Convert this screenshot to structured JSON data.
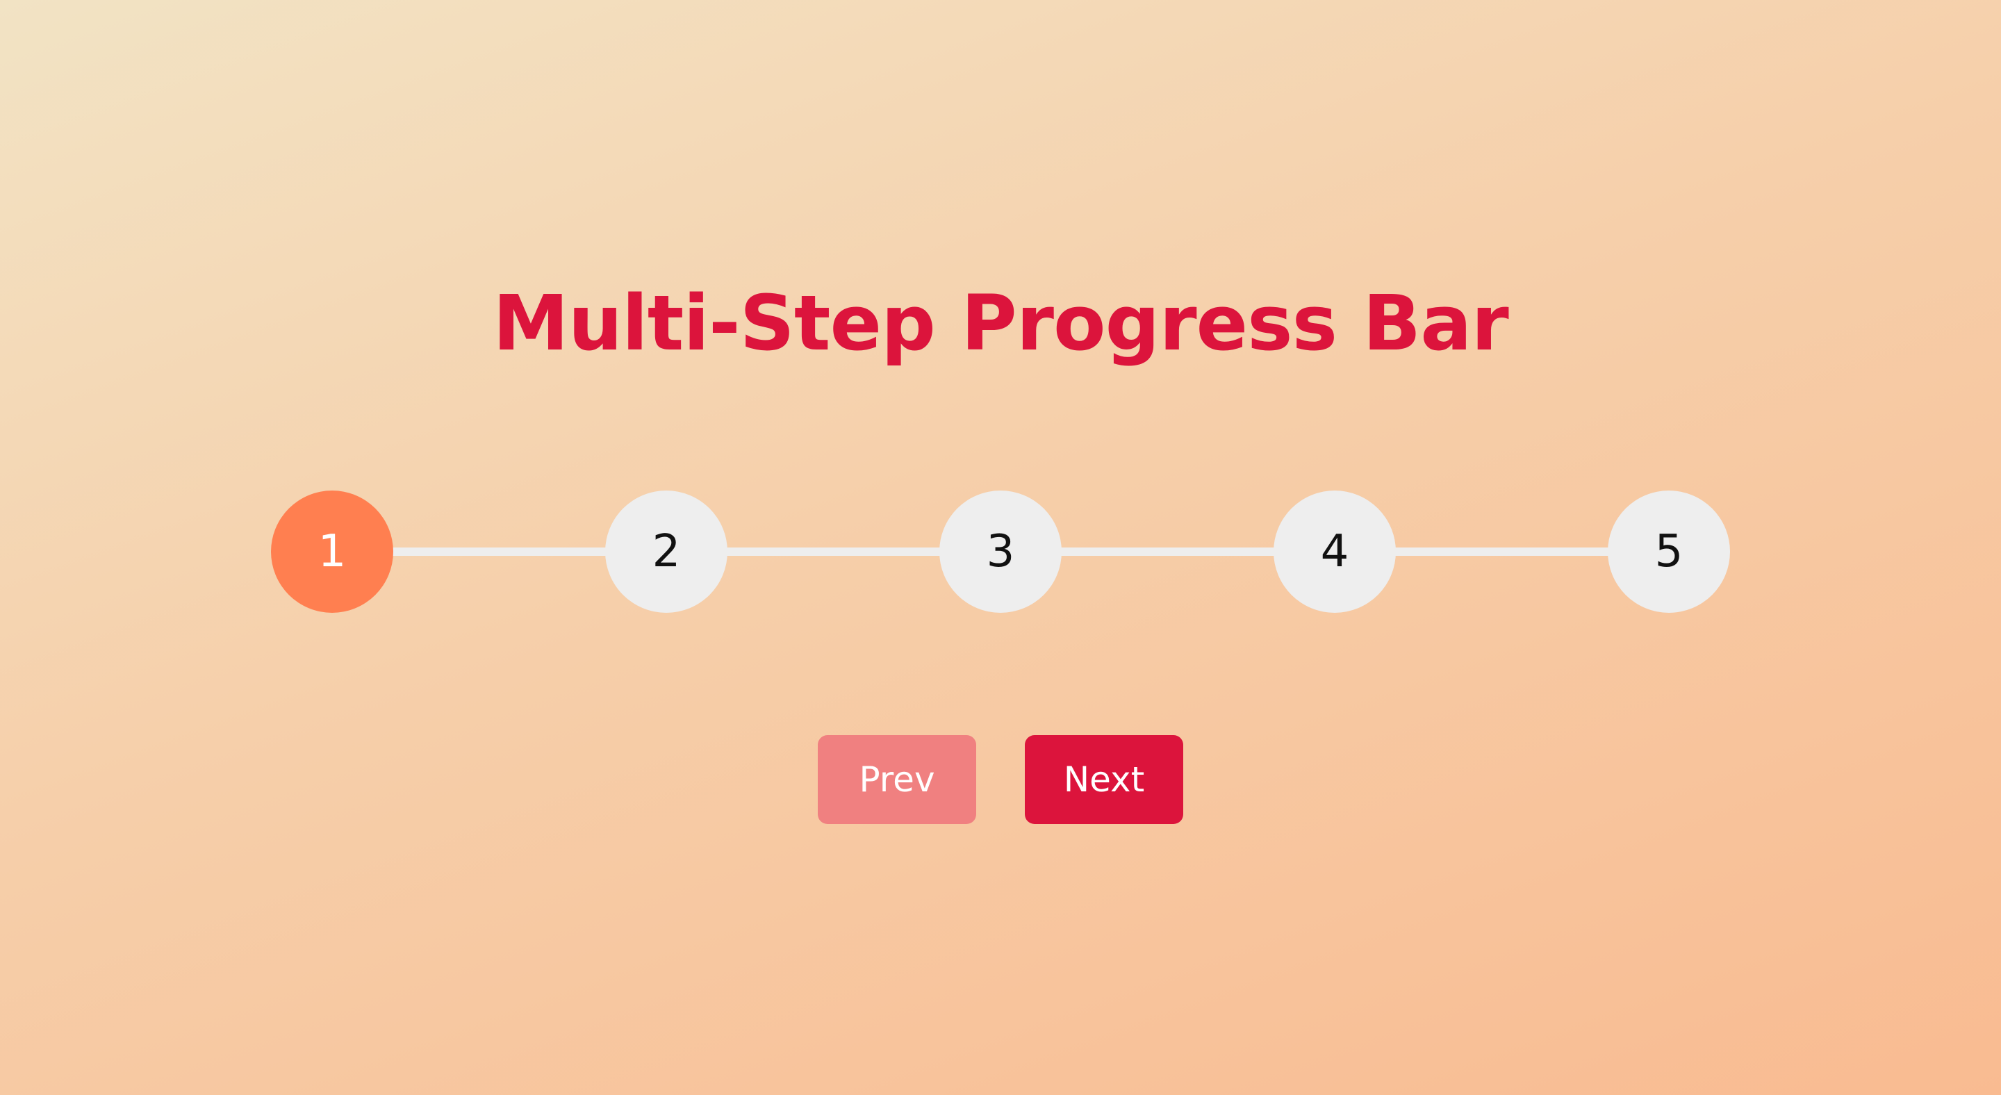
{
  "title": "Multi-Step Progress Bar",
  "progress": {
    "current_step": 1,
    "total_steps": 5,
    "fill_fraction": 0,
    "steps": [
      {
        "label": "1",
        "state": "active"
      },
      {
        "label": "2",
        "state": "inactive"
      },
      {
        "label": "3",
        "state": "inactive"
      },
      {
        "label": "4",
        "state": "inactive"
      },
      {
        "label": "5",
        "state": "inactive"
      }
    ]
  },
  "buttons": {
    "prev_label": "Prev",
    "prev_state": "disabled",
    "next_label": "Next"
  },
  "colors": {
    "title": "#dc143c",
    "active_step": "#ff7f50",
    "inactive_step": "#eeeeee",
    "prev_button": "#f08080",
    "next_button": "#dc143c"
  }
}
